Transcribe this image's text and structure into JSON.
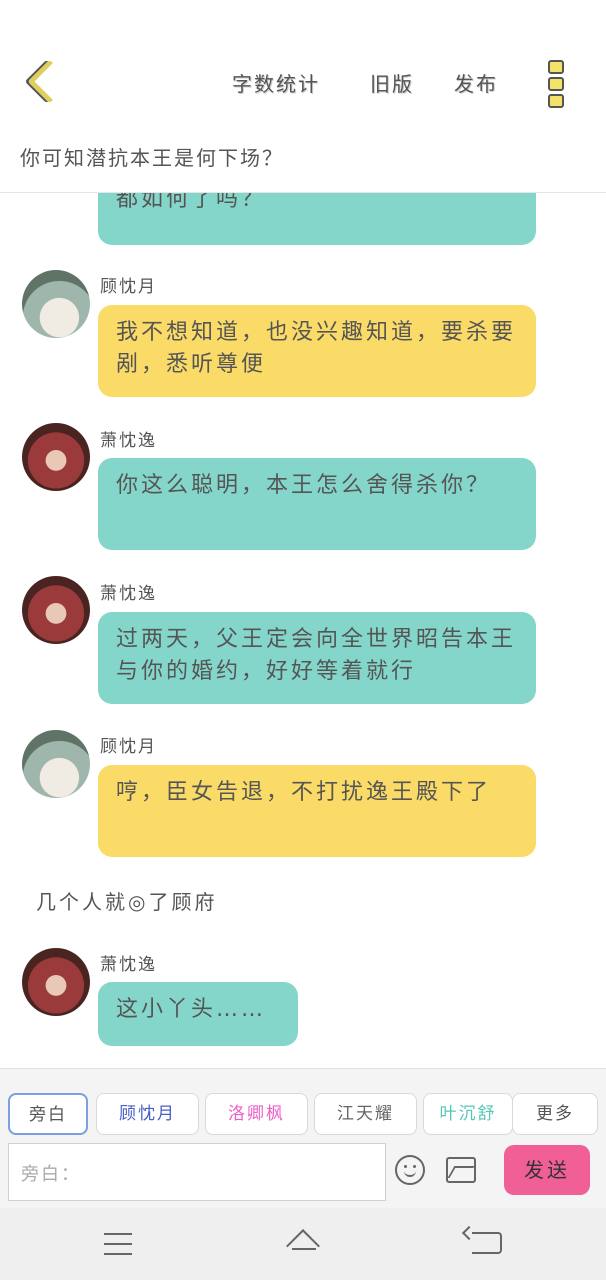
{
  "header": {
    "back_icon": "chevron-left-icon",
    "stats_label": "字数统计",
    "old_version_label": "旧版",
    "publish_label": "发布",
    "more_icon": "more-vertical-icon",
    "story_title": "你可知潜抗本王是何下场？"
  },
  "messages": [
    {
      "speaker": "",
      "text": "都如何了吗？",
      "style": "teal"
    },
    {
      "speaker": "顾忱月",
      "text": "我不想知道，也没兴趣知道，要杀要剐，悉听尊便",
      "style": "yellow",
      "avatar": "avatar-gu"
    },
    {
      "speaker": "萧忱逸",
      "text": "你这么聪明，本王怎么舍得杀你？",
      "style": "teal",
      "avatar": "avatar-xiao"
    },
    {
      "speaker": "萧忱逸",
      "text": "过两天，父王定会向全世界昭告本王与你的婚约，好好等着就行",
      "style": "teal",
      "avatar": "avatar-xiao"
    },
    {
      "speaker": "顾忱月",
      "text": "哼，臣女告退，不打扰逸王殿下了",
      "style": "yellow",
      "avatar": "avatar-gu"
    },
    {
      "speaker": "萧忱逸",
      "text": "这小丫头……",
      "style": "teal",
      "avatar": "avatar-xiao"
    }
  ],
  "system_message": "几个人就◎了顾府",
  "roles": [
    "旁白",
    "顾忱月",
    "洛卿枫",
    "江天耀",
    "叶沉舒"
  ],
  "role_colors": [
    "#555555",
    "#4a5fc7",
    "#ee60c8",
    "#666666",
    "#56c6b8"
  ],
  "more_roles_label": "更多",
  "input": {
    "placeholder": "旁白："
  },
  "send_label": "发送",
  "icons": {
    "emoji": "emoji-icon",
    "image": "image-icon",
    "menu": "menu-icon",
    "home": "home-icon",
    "back": "back-icon"
  }
}
